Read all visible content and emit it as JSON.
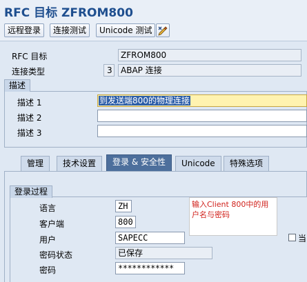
{
  "title": "RFC 目标 ZFROM800",
  "toolbar": {
    "remote_login": "远程登录",
    "connection_test": "连接测试",
    "unicode_test": "Unicode 测试"
  },
  "header": {
    "rfc_dest_label": "RFC 目标",
    "rfc_dest_value": "ZFROM800",
    "conn_type_label": "连接类型",
    "conn_type_code": "3",
    "conn_type_text": "ABAP 连接"
  },
  "description": {
    "group_title": "描述",
    "desc1_label": "描述 1",
    "desc1_value": "到发送端800的物理连接",
    "desc2_label": "描述 2",
    "desc2_value": "",
    "desc3_label": "描述 3",
    "desc3_value": ""
  },
  "tabs": [
    {
      "label": "管理"
    },
    {
      "label": "技术设置"
    },
    {
      "label": "登录 & 安全性"
    },
    {
      "label": "Unicode"
    },
    {
      "label": "特殊选项"
    }
  ],
  "logon": {
    "group_title": "登录过程",
    "language_label": "语言",
    "language_value": "ZH",
    "client_label": "客户端",
    "client_value": "800",
    "user_label": "用户",
    "user_value": "SAPECC",
    "pw_status_label": "密码状态",
    "pw_status_value": "已保存",
    "password_label": "密码",
    "password_value": "************",
    "note": "输入Client 800中的用户名与密码",
    "checkbox_label": "当"
  }
}
